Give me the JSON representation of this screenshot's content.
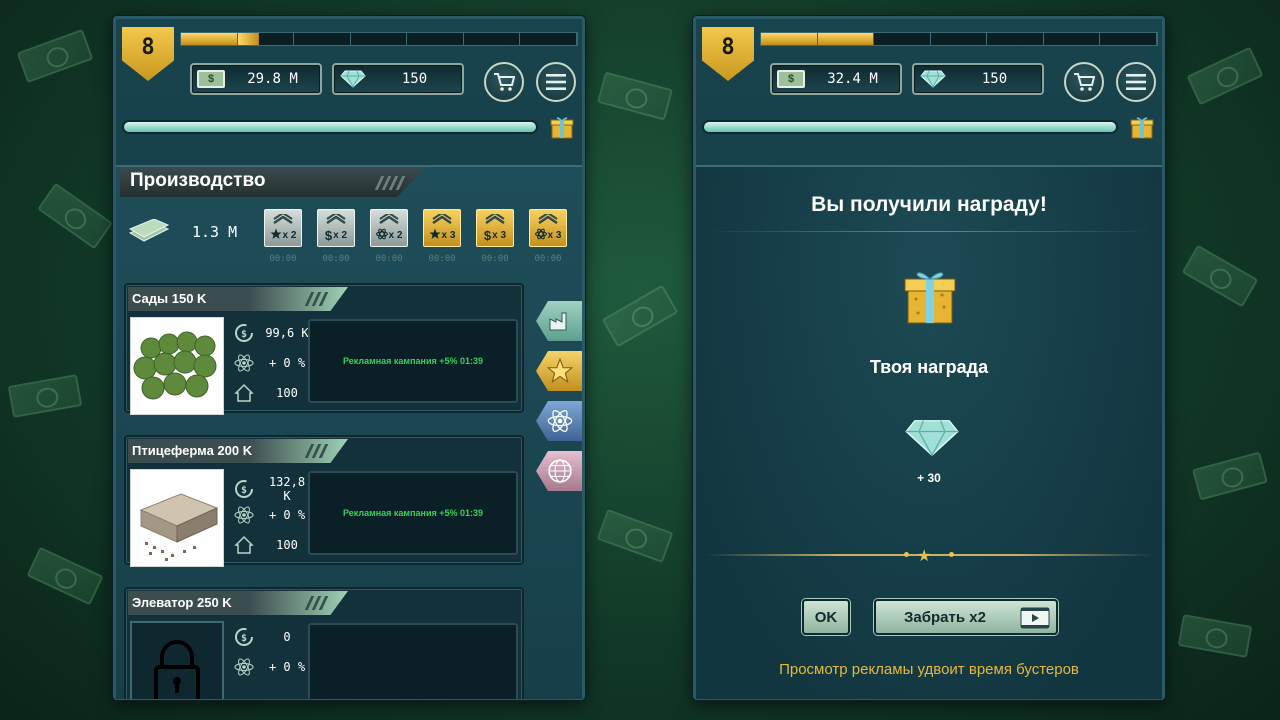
{
  "left": {
    "level": "8",
    "cash": "29.8 M",
    "gems": "150",
    "section_title": "Производство",
    "income": "1.3 M",
    "boosts": [
      {
        "icon": "star-icon",
        "mult": "x 2",
        "tier": "silver",
        "timer": "00:00"
      },
      {
        "icon": "dollar-icon",
        "mult": "x 2",
        "tier": "silver",
        "timer": "00:00"
      },
      {
        "icon": "atom-icon",
        "mult": "x 2",
        "tier": "silver",
        "timer": "00:00"
      },
      {
        "icon": "star-icon",
        "mult": "x 3",
        "tier": "gold",
        "timer": "00:00"
      },
      {
        "icon": "dollar-icon",
        "mult": "x 3",
        "tier": "gold",
        "timer": "00:00"
      },
      {
        "icon": "atom-icon",
        "mult": "x 3",
        "tier": "gold",
        "timer": "00:00"
      }
    ],
    "cards": [
      {
        "title": "Сады 150 K",
        "income": "99,6 K",
        "bonus": "+ 0 %",
        "capacity": "100",
        "ad": "Рекламная кампания +5%   01:39"
      },
      {
        "title": "Птицеферма 200 K",
        "income": "132,8 K",
        "bonus": "+ 0 %",
        "capacity": "100",
        "ad": "Рекламная кампания +5%   01:39"
      },
      {
        "title": "Элеватор 250 K",
        "income": "0",
        "bonus": "+ 0 %"
      }
    ],
    "side_tabs": [
      "factory-icon",
      "star-icon",
      "atom-icon",
      "globe-icon"
    ]
  },
  "right": {
    "level": "8",
    "cash": "32.4 M",
    "gems": "150",
    "reward": {
      "title": "Вы получили награду!",
      "subtitle": "Твоя награда",
      "amount": "+ 30",
      "ok_label": "OK",
      "double_label": "Забрать x2",
      "hint": "Просмотр рекламы удвоит время бустеров"
    }
  },
  "colors": {
    "gold": "#f2c94c",
    "teal_bar": "#64c5b2",
    "ad_green": "#39d05a",
    "hint": "#e7b93a"
  }
}
